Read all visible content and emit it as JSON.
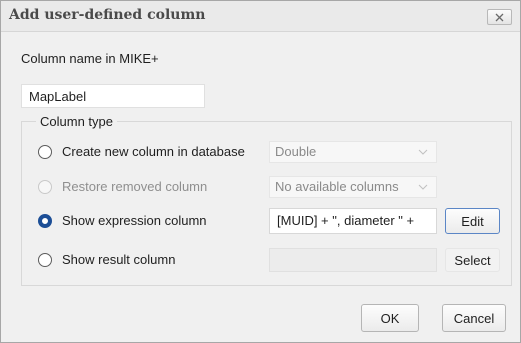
{
  "dialog": {
    "title": "Add user-defined column",
    "close_label": "x"
  },
  "column_name": {
    "label": "Column name in MIKE+",
    "value": "MapLabel"
  },
  "column_type": {
    "legend": "Column type",
    "options": [
      {
        "label": "Create new column in database",
        "checked": false,
        "enabled": true,
        "combo_value": "Double"
      },
      {
        "label": "Restore removed column",
        "checked": false,
        "enabled": false,
        "combo_value": "No available columns"
      },
      {
        "label": "Show expression column",
        "checked": true,
        "enabled": true,
        "expression": "[MUID] + \", diameter \" +",
        "button_label": "Edit"
      },
      {
        "label": "Show result column",
        "checked": false,
        "enabled": true,
        "button_label": "Select"
      }
    ]
  },
  "footer": {
    "ok_label": "OK",
    "cancel_label": "Cancel"
  },
  "colors": {
    "radio_selected": "#1c4e96",
    "focus_border": "#5b86c6"
  }
}
